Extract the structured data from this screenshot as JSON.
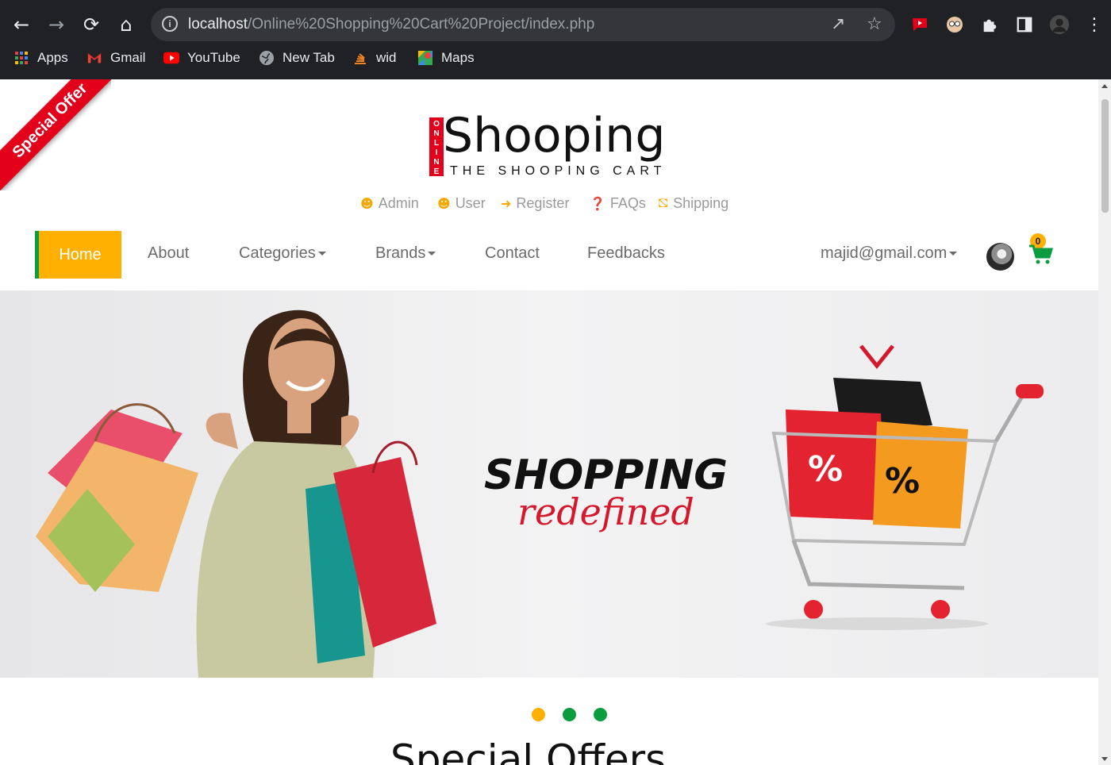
{
  "browser": {
    "url_host": "localhost",
    "url_path": "/Online%20Shopping%20Cart%20Project/index.php",
    "bookmarks": [
      {
        "label": "Apps",
        "icon": "apps-grid-icon"
      },
      {
        "label": "Gmail",
        "icon": "gmail-icon"
      },
      {
        "label": "YouTube",
        "icon": "youtube-icon"
      },
      {
        "label": "New Tab",
        "icon": "globe-icon"
      },
      {
        "label": "wid",
        "icon": "stack-icon"
      },
      {
        "label": "Maps",
        "icon": "maps-icon"
      }
    ]
  },
  "site": {
    "ribbon": "Special Offer",
    "logo": {
      "vertical": [
        "O",
        "N",
        "L",
        "I",
        "N",
        "E"
      ],
      "title": "Shooping",
      "tagline": "THE SHOOPING CART"
    },
    "top_links": [
      {
        "label": "Admin",
        "icon": "user-icon"
      },
      {
        "label": "User",
        "icon": "user-icon"
      },
      {
        "label": "Register",
        "icon": "arrow-right-icon"
      },
      {
        "label": "FAQs",
        "icon": "question-circle-icon"
      },
      {
        "label": "Shipping",
        "icon": "truck-icon"
      }
    ],
    "nav": {
      "home": "Home",
      "about": "About",
      "categories": "Categories",
      "brands": "Brands",
      "contact": "Contact",
      "feedbacks": "Feedbacks",
      "account": "majid@gmail.com",
      "cart_count": "0"
    },
    "banner": {
      "headline": "SHOPPING",
      "script": "redefined"
    },
    "section_heading": "Special Offers",
    "colors": {
      "accent_yellow": "#ffb000",
      "accent_green": "#0b9c3f",
      "ribbon_red": "#e3001b"
    }
  }
}
